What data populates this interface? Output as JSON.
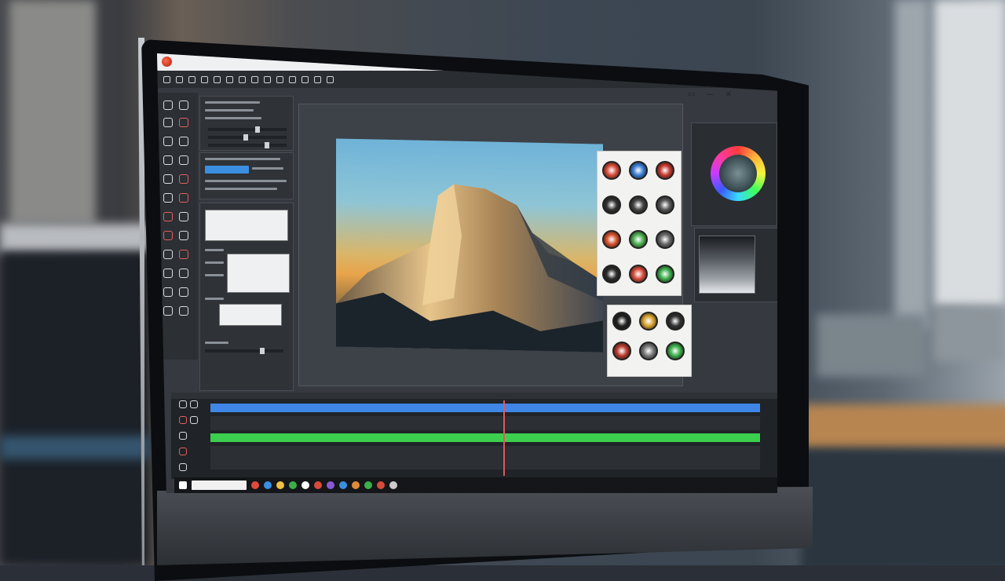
{
  "app": {
    "title": "",
    "brand_color": "#d13a2a"
  },
  "window_controls": [
    "▭",
    "—",
    "✕"
  ],
  "viewer": {
    "tab_label": ""
  },
  "taskbar": {
    "search_placeholder": ""
  },
  "colors": {
    "timeline_track_1": "#3f86e6",
    "timeline_track_2": "#3ccf4f",
    "playhead": "#e2585a"
  },
  "icons": {
    "toolbar": [
      "file-icon",
      "open-icon",
      "save-icon",
      "undo-icon",
      "redo-icon",
      "cut-icon",
      "copy-icon",
      "paste-icon",
      "crop-icon",
      "rotate-icon",
      "brush-icon",
      "text-icon",
      "zoom-icon",
      "settings-icon"
    ],
    "taskbar": [
      "start-icon",
      "browser-icon",
      "mail-icon",
      "folder-icon",
      "store-icon",
      "editor-icon",
      "media-icon",
      "photos-icon",
      "chat-icon",
      "music-icon",
      "game-icon",
      "tools-icon",
      "settings-icon"
    ]
  },
  "stickers_top": [
    {
      "name": "sticker-red-ring",
      "color": "#d64b3a"
    },
    {
      "name": "sticker-blue-ring",
      "color": "#3a7fd6"
    },
    {
      "name": "sticker-red-dots",
      "color": "#c53a2e"
    },
    {
      "name": "sticker-dark-1",
      "color": "#333333"
    },
    {
      "name": "sticker-dark-2",
      "color": "#444444"
    },
    {
      "name": "sticker-dark-3",
      "color": "#555555"
    },
    {
      "name": "sticker-red-dots-2",
      "color": "#d6512e"
    },
    {
      "name": "sticker-green-red",
      "color": "#4caf50"
    },
    {
      "name": "sticker-grey",
      "color": "#666666"
    },
    {
      "name": "sticker-dark-4",
      "color": "#2c2c2c"
    },
    {
      "name": "sticker-red-ring-2",
      "color": "#d64b3a"
    },
    {
      "name": "sticker-green",
      "color": "#3cae4a"
    }
  ],
  "stickers_bottom": [
    {
      "name": "sticker-heart-dark",
      "color": "#222222"
    },
    {
      "name": "sticker-heart-gold",
      "color": "#d7a12e"
    },
    {
      "name": "sticker-heart-dark-2",
      "color": "#333333"
    },
    {
      "name": "sticker-heart-red",
      "color": "#b93a2e"
    },
    {
      "name": "sticker-heart-grey",
      "color": "#777777"
    },
    {
      "name": "sticker-heart-green",
      "color": "#3cae4a"
    }
  ]
}
